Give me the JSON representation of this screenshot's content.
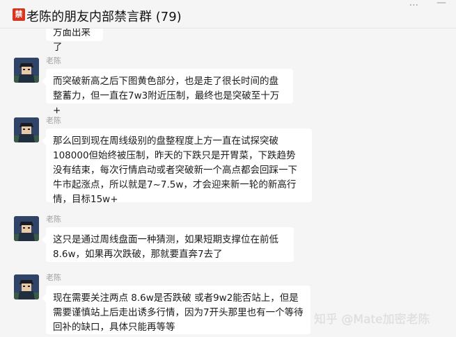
{
  "window": {
    "badge": "禁",
    "title": "老陈的朋友内部禁言群 (79)",
    "controls": [
      "...",
      "—"
    ]
  },
  "messages": [
    {
      "sender": "",
      "text": "方面出来了",
      "partial": true
    },
    {
      "sender": "老陈",
      "text": "而突破新高之后下图黄色部分，也是走了很长时间的盘整蓄力，但一直在7w3附近压制，最终也是突破至十万+"
    },
    {
      "sender": "老陈",
      "text": "那么回到现在周线级别的盘整程度上方一直在试探突破108000但始终被压制，昨天的下跌只是开胃菜，下跌趋势没有结束，每次行情启动或者突破新一个高点都会回踩一下牛市起涨点，所以就是7~7.5w，才会迎来新一轮的新高行情，目标15w+"
    },
    {
      "sender": "老陈",
      "text": "这只是通过周线盘面一种猜测，如果短期支撑位在前低8.6w，如果再次跌破，那就要直奔7去了"
    },
    {
      "sender": "老陈",
      "text": "现在需要关注两点 8.6w是否跌破 或者9w2能否站上，但是需要谨慎站上后走出诱多行情，因为7开头那里也有一个等待回补的缺口，具体只能再等等"
    }
  ],
  "watermark": "知乎 @Mate加密老陈"
}
